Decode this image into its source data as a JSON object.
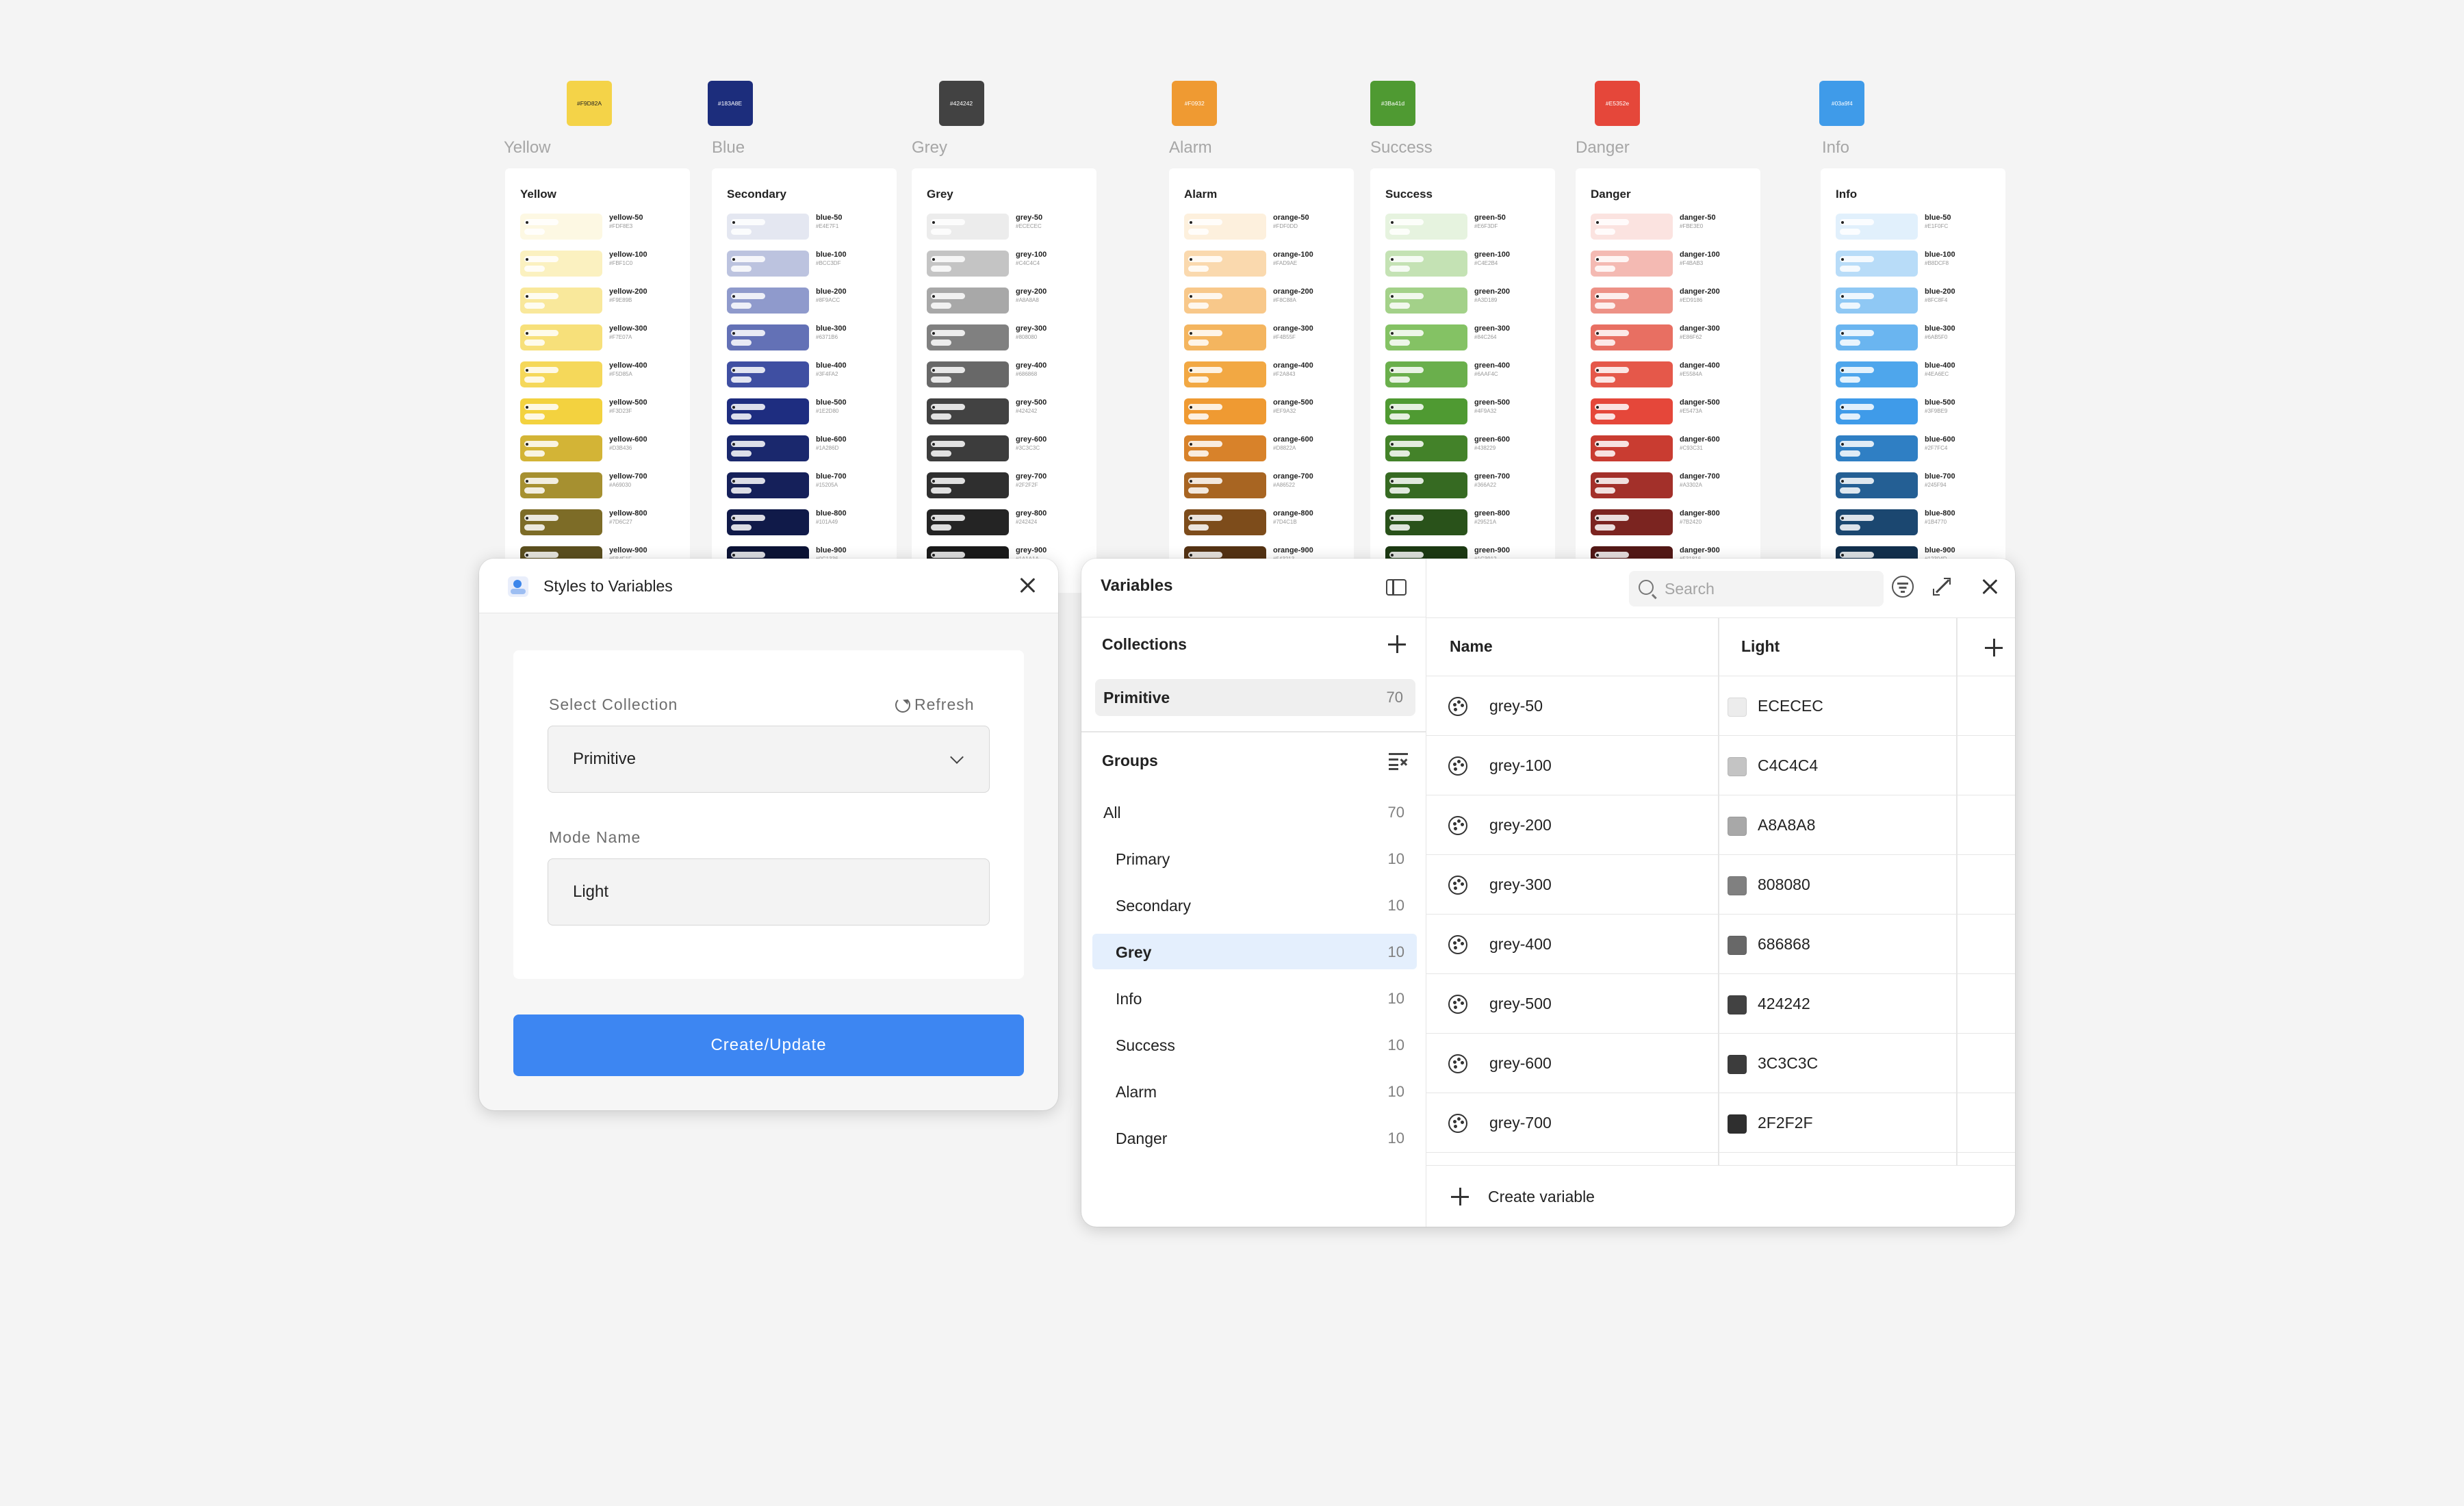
{
  "canvas": {
    "swatches": [
      {
        "label": "Yellow",
        "hex": "#F9D82A",
        "color": "#f4d348",
        "text": "#222"
      },
      {
        "label": "Blue",
        "hex": "#183A8E",
        "color": "#1c2d7c",
        "text": "#fff"
      },
      {
        "label": "Grey",
        "hex": "#424242",
        "color": "#424242",
        "text": "#fff"
      },
      {
        "label": "Alarm",
        "hex": "#F0932",
        "color": "#ef9a32",
        "text": "#fff"
      },
      {
        "label": "Success",
        "hex": "#3Ba41d",
        "color": "#4f9a32",
        "text": "#fff"
      },
      {
        "label": "Danger",
        "hex": "#E5352e",
        "color": "#e5473a",
        "text": "#fff"
      },
      {
        "label": "Info",
        "hex": "#03a9f4",
        "color": "#3f9be9",
        "text": "#fff"
      }
    ],
    "cards": [
      {
        "title": "Yellow",
        "prefix": "yellow",
        "colors": [
          "#fdf8e3",
          "#fbf1c0",
          "#f9e89b",
          "#f7e07a",
          "#f5d85a",
          "#f3d23f",
          "#d3b436",
          "#a69030",
          "#7d6c27",
          "#5b4f1f"
        ]
      },
      {
        "title": "Secondary",
        "prefix": "blue",
        "colors": [
          "#e4e7f1",
          "#bcc3df",
          "#8f9acc",
          "#6371b6",
          "#3f4fa2",
          "#1e2d80",
          "#1a286d",
          "#15205a",
          "#101a49",
          "#0c1336"
        ]
      },
      {
        "title": "Grey",
        "prefix": "grey",
        "colors": [
          "#ececec",
          "#c4c4c4",
          "#a8a8a8",
          "#808080",
          "#686868",
          "#424242",
          "#3c3c3c",
          "#2f2f2f",
          "#242424",
          "#1a1a1a"
        ]
      },
      {
        "title": "Alarm",
        "prefix": "orange",
        "colors": [
          "#fdf0dd",
          "#fad9ae",
          "#f8c88a",
          "#f4b55f",
          "#f2a843",
          "#ef9a32",
          "#d8822a",
          "#a86522",
          "#7d4c1b",
          "#543213"
        ]
      },
      {
        "title": "Success",
        "prefix": "green",
        "colors": [
          "#e6f3df",
          "#c4e2b4",
          "#a3d189",
          "#84c264",
          "#6aaf4c",
          "#4f9a32",
          "#438229",
          "#366a22",
          "#29521a",
          "#1c3912"
        ]
      },
      {
        "title": "Danger",
        "prefix": "danger",
        "colors": [
          "#fbe3e0",
          "#f4bab3",
          "#ed9186",
          "#e86f62",
          "#e5584a",
          "#e5473a",
          "#c93c31",
          "#a3302a",
          "#7b2420",
          "#531816"
        ]
      },
      {
        "title": "Info",
        "prefix": "blue",
        "colors": [
          "#e1f0fc",
          "#b8dcf8",
          "#8fc8f4",
          "#6ab5f0",
          "#4ea6ec",
          "#3f9be9",
          "#2f7fc4",
          "#245f94",
          "#1b4770",
          "#12304d"
        ]
      }
    ],
    "steps": [
      "50",
      "100",
      "200",
      "300",
      "400",
      "500",
      "600",
      "700",
      "800",
      "900"
    ]
  },
  "plugin": {
    "title": "Styles to Variables",
    "select_label": "Select Collection",
    "refresh_label": "Refresh",
    "select_value": "Primitive",
    "mode_label": "Mode Name",
    "mode_value": "Light",
    "button_label": "Create/Update"
  },
  "variables": {
    "title": "Variables",
    "collections_label": "Collections",
    "collection": {
      "name": "Primitive",
      "count": "70"
    },
    "groups_label": "Groups",
    "groups": [
      {
        "name": "All",
        "count": "70",
        "indent": false,
        "active": false
      },
      {
        "name": "Primary",
        "count": "10",
        "indent": true,
        "active": false
      },
      {
        "name": "Secondary",
        "count": "10",
        "indent": true,
        "active": false
      },
      {
        "name": "Grey",
        "count": "10",
        "indent": true,
        "active": true
      },
      {
        "name": "Info",
        "count": "10",
        "indent": true,
        "active": false
      },
      {
        "name": "Success",
        "count": "10",
        "indent": true,
        "active": false
      },
      {
        "name": "Alarm",
        "count": "10",
        "indent": true,
        "active": false
      },
      {
        "name": "Danger",
        "count": "10",
        "indent": true,
        "active": false
      }
    ],
    "search_placeholder": "Search",
    "col_name": "Name",
    "col_mode": "Light",
    "rows": [
      {
        "name": "grey-50",
        "value": "ECECEC",
        "color": "#ECECEC"
      },
      {
        "name": "grey-100",
        "value": "C4C4C4",
        "color": "#C4C4C4"
      },
      {
        "name": "grey-200",
        "value": "A8A8A8",
        "color": "#A8A8A8"
      },
      {
        "name": "grey-300",
        "value": "808080",
        "color": "#808080"
      },
      {
        "name": "grey-400",
        "value": "686868",
        "color": "#686868"
      },
      {
        "name": "grey-500",
        "value": "424242",
        "color": "#424242"
      },
      {
        "name": "grey-600",
        "value": "3C3C3C",
        "color": "#3C3C3C"
      },
      {
        "name": "grey-700",
        "value": "2F2F2F",
        "color": "#2F2F2F"
      }
    ],
    "create_label": "Create variable"
  }
}
